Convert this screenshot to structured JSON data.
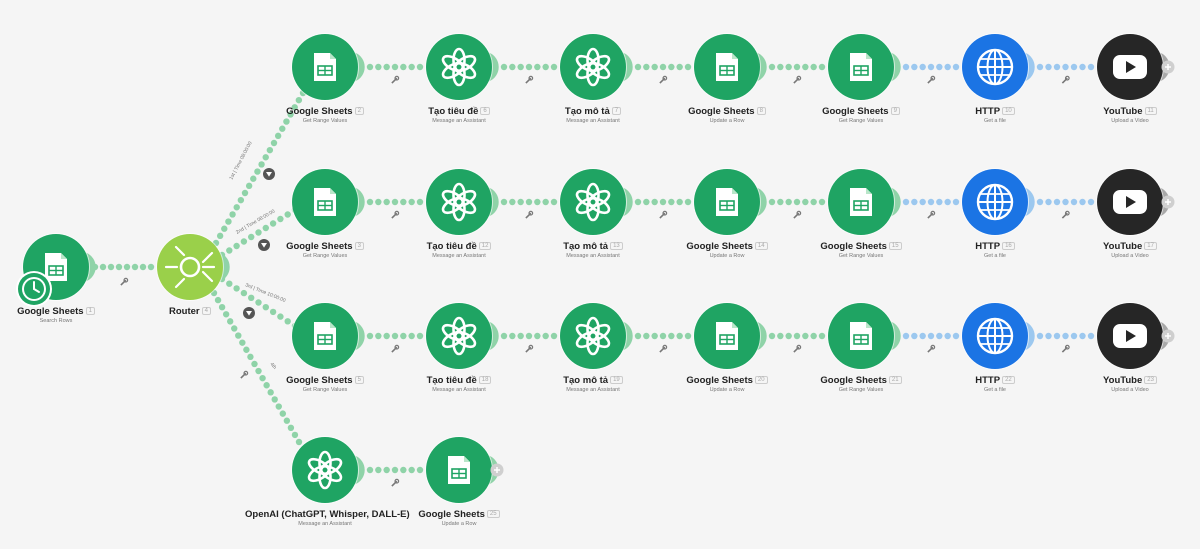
{
  "colors": {
    "green": "#1fa463",
    "green_line": "#8fd3a8",
    "router": "#9ad04a",
    "http": "#1b74e4",
    "http_line": "#9cc8ef",
    "youtube": "#262626",
    "youtube_line": "#a8a8a8",
    "filter_icon": "#555555"
  },
  "trigger": {
    "title": "Google Sheets",
    "num": "1",
    "sub": "Search Rows",
    "icon": "sheets-icon",
    "badge": "clock-icon"
  },
  "router": {
    "title": "Router",
    "num": "4",
    "icon": "router-icon"
  },
  "branch_labels": [
    "1st | Time 08:00:00",
    "2nd | Time 08:00:00",
    "3rd | Time 10:00:00",
    "4th"
  ],
  "routes": [
    [
      {
        "title": "Google Sheets",
        "num": "2",
        "sub": "Get Range Values",
        "icon": "sheets-icon"
      },
      {
        "title": "Tạo tiêu đề",
        "num": "6",
        "sub": "Message an Assistant",
        "icon": "openai-icon"
      },
      {
        "title": "Tạo mô tả",
        "num": "7",
        "sub": "Message an Assistant",
        "icon": "openai-icon"
      },
      {
        "title": "Google Sheets",
        "num": "8",
        "sub": "Update a Row",
        "icon": "sheets-icon"
      },
      {
        "title": "Google Sheets",
        "num": "9",
        "sub": "Get Range Values",
        "icon": "sheets-icon"
      },
      {
        "title": "HTTP",
        "num": "10",
        "sub": "Get a file",
        "icon": "globe-icon"
      },
      {
        "title": "YouTube",
        "num": "11",
        "sub": "Upload a Video",
        "icon": "youtube-icon"
      }
    ],
    [
      {
        "title": "Google Sheets",
        "num": "3",
        "sub": "Get Range Values",
        "icon": "sheets-icon"
      },
      {
        "title": "Tạo tiêu đề",
        "num": "12",
        "sub": "Message an Assistant",
        "icon": "openai-icon"
      },
      {
        "title": "Tạo mô tả",
        "num": "13",
        "sub": "Message an Assistant",
        "icon": "openai-icon"
      },
      {
        "title": "Google Sheets",
        "num": "14",
        "sub": "Update a Row",
        "icon": "sheets-icon"
      },
      {
        "title": "Google Sheets",
        "num": "15",
        "sub": "Get Range Values",
        "icon": "sheets-icon"
      },
      {
        "title": "HTTP",
        "num": "16",
        "sub": "Get a file",
        "icon": "globe-icon"
      },
      {
        "title": "YouTube",
        "num": "17",
        "sub": "Upload a Video",
        "icon": "youtube-icon"
      }
    ],
    [
      {
        "title": "Google Sheets",
        "num": "5",
        "sub": "Get Range Values",
        "icon": "sheets-icon"
      },
      {
        "title": "Tạo tiêu đề",
        "num": "18",
        "sub": "Message an Assistant",
        "icon": "openai-icon"
      },
      {
        "title": "Tạo mô tả",
        "num": "19",
        "sub": "Message an Assistant",
        "icon": "openai-icon"
      },
      {
        "title": "Google Sheets",
        "num": "20",
        "sub": "Update a Row",
        "icon": "sheets-icon"
      },
      {
        "title": "Google Sheets",
        "num": "21",
        "sub": "Get Range Values",
        "icon": "sheets-icon"
      },
      {
        "title": "HTTP",
        "num": "22",
        "sub": "Get a file",
        "icon": "globe-icon"
      },
      {
        "title": "YouTube",
        "num": "23",
        "sub": "Upload a Video",
        "icon": "youtube-icon"
      }
    ],
    [
      {
        "title": "OpenAI (ChatGPT, Whisper, DALL-E)",
        "num": "",
        "sub": "Message an Assistant",
        "icon": "openai-icon"
      },
      {
        "title": "Google Sheets",
        "num": "25",
        "sub": "Update a Row",
        "icon": "sheets-icon"
      }
    ]
  ]
}
